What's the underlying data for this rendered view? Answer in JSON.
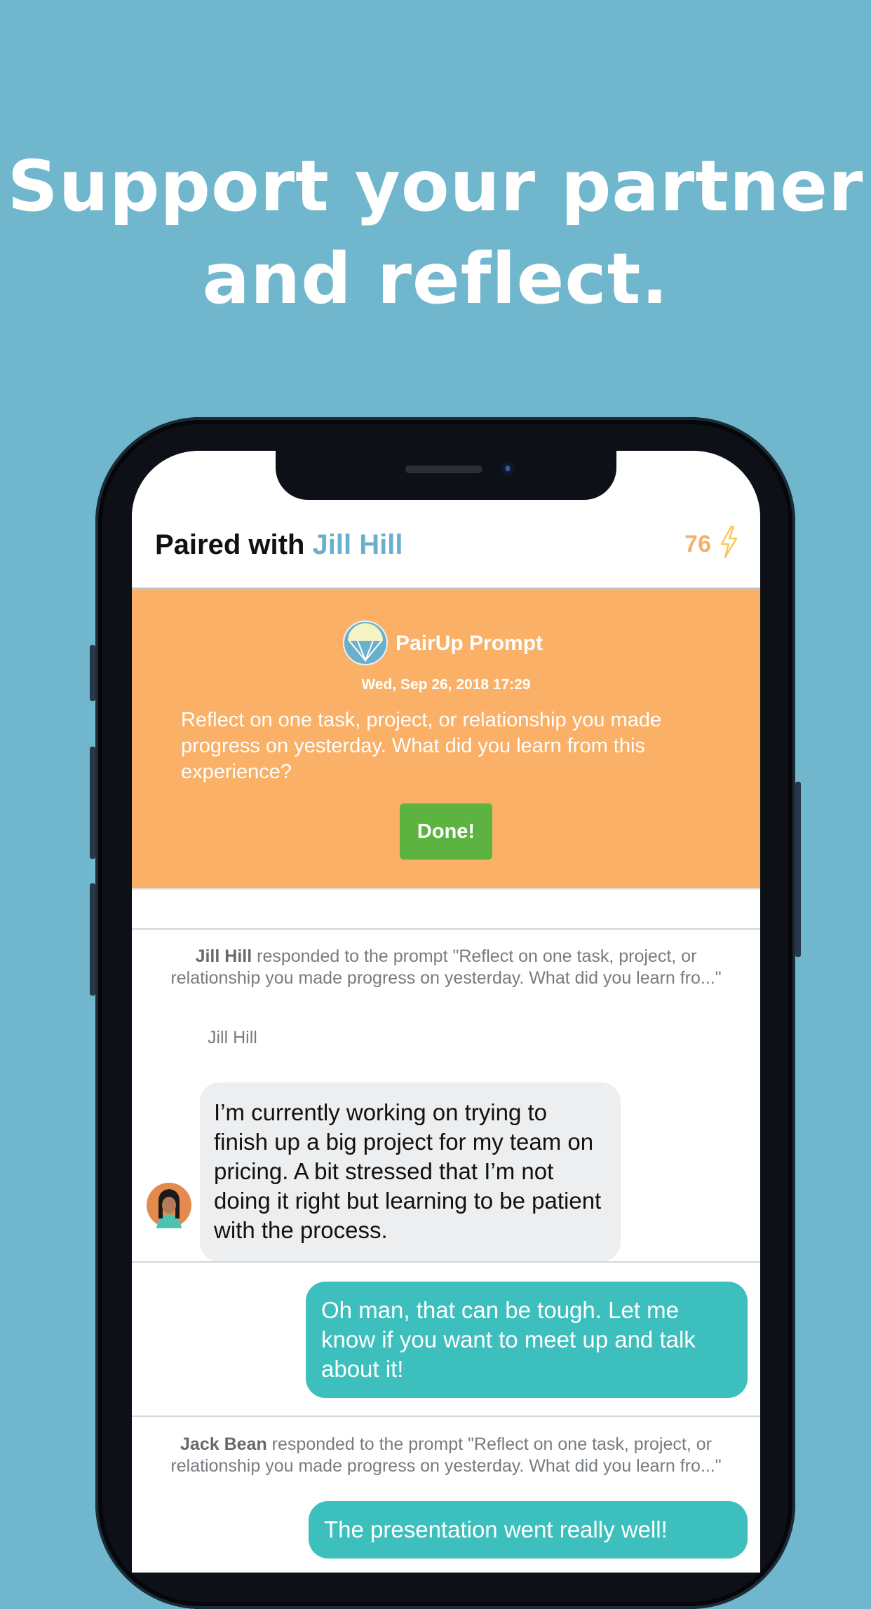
{
  "headline": {
    "line1": "Support your partner",
    "line2": "and reflect."
  },
  "header": {
    "paired_prefix": "Paired with ",
    "partner_name": "Jill Hill",
    "points": "76"
  },
  "prompt": {
    "title": "PairUp Prompt",
    "date": "Wed, Sep 26, 2018 17:29",
    "text": "Reflect on one task, project, or relationship you made progress on yesterday. What did you learn from this experience?",
    "done_label": "Done!"
  },
  "feed": {
    "response1": {
      "name": "Jill Hill",
      "text": " responded to the prompt \"Reflect on one task, project, or relationship you made progress on yesterday. What did you learn fro...\""
    },
    "sender_label": "Jill Hill",
    "message_in": "I’m currently working on trying to finish up a big project for my team on pricing. A bit stressed that I’m not doing it right but learning to be patient with the process.",
    "message_out1": "Oh man, that can be tough. Let me know if you want to meet up and talk about it!",
    "response2": {
      "name": "Jack Bean",
      "text": " responded to the prompt \"Reflect on one task, project, or relationship you made progress on yesterday. What did you learn fro...\""
    },
    "message_out2": "The presentation went really well!"
  },
  "colors": {
    "background": "#70b7cd",
    "partner": "#6ab0cd",
    "points": "#f6b06a",
    "prompt_bg": "#fab066",
    "done": "#5cb33f",
    "bubble_out": "#3dbfbe",
    "bubble_in": "#eceef0"
  },
  "icons": [
    "lightning-bolt-icon",
    "parachute-logo-icon",
    "avatar-icon"
  ]
}
